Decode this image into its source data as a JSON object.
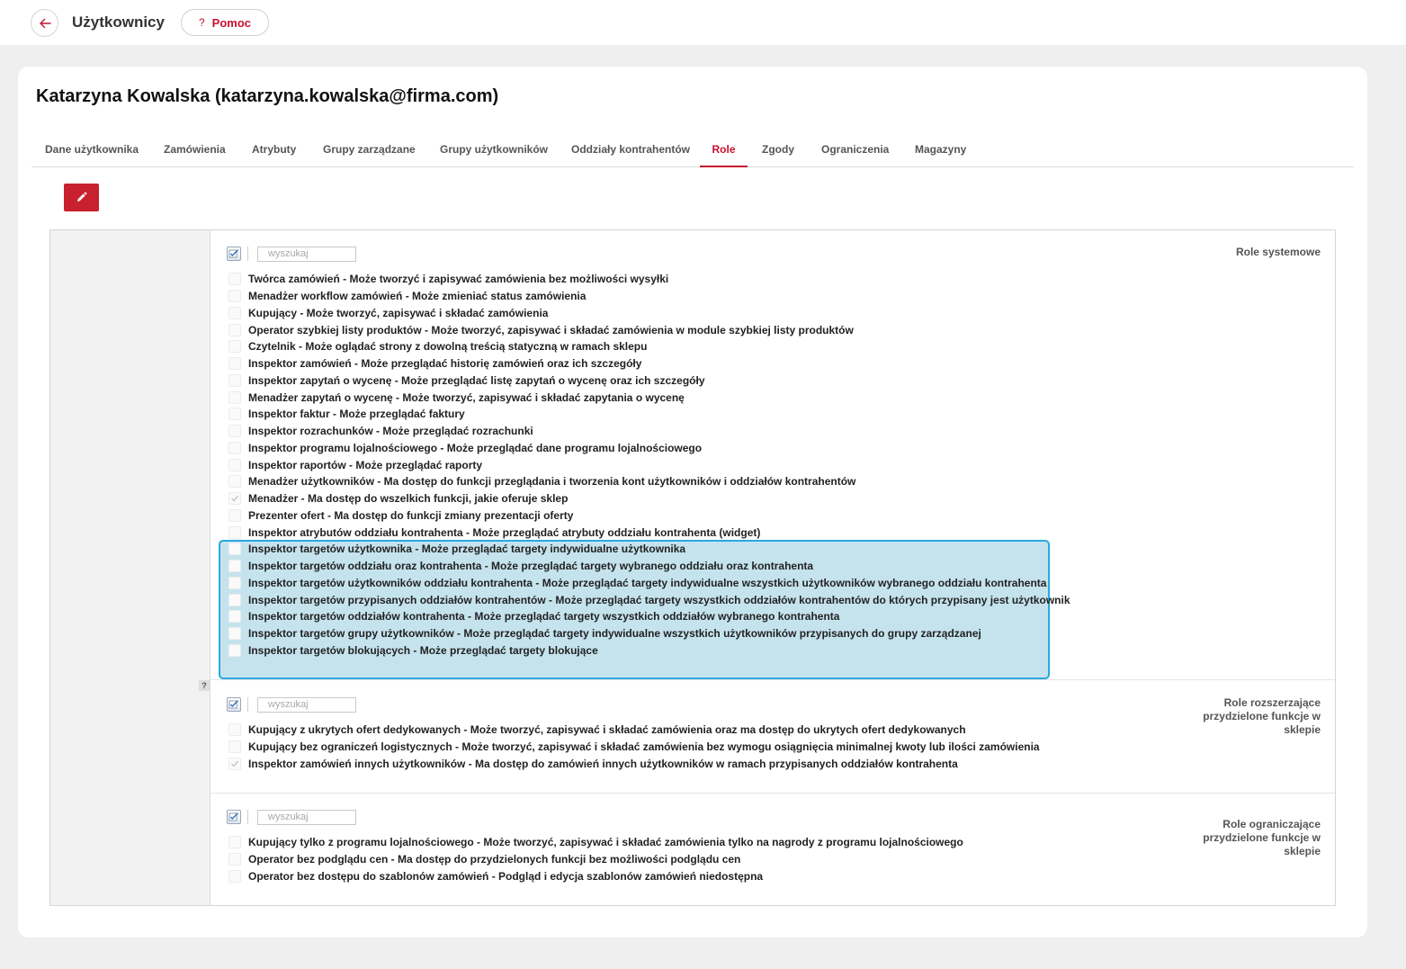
{
  "header": {
    "title": "Użytkownicy",
    "help_label": "Pomoc",
    "help_icon": "?"
  },
  "user": {
    "heading": "Katarzyna Kowalska (katarzyna.kowalska@firma.com)"
  },
  "tabs": [
    {
      "label": "Dane użytkownika"
    },
    {
      "label": "Zamówienia"
    },
    {
      "label": "Atrybuty"
    },
    {
      "label": "Grupy zarządzane"
    },
    {
      "label": "Grupy użytkowników"
    },
    {
      "label": "Oddziały kontrahentów"
    },
    {
      "label": "Role",
      "active": true
    },
    {
      "label": "Zgody"
    },
    {
      "label": "Ograniczenia"
    },
    {
      "label": "Magazyny"
    }
  ],
  "colors": {
    "accent": "#c8102e",
    "highlight_border": "#2aa8df",
    "highlight_fill": "#a9d5e3"
  },
  "sections": [
    {
      "label": "Role systemowe",
      "search_placeholder": "wyszukaj",
      "roles": [
        {
          "text": "Twórca zamówień - Może tworzyć i zapisywać zamówienia bez możliwości wysyłki",
          "checked": false
        },
        {
          "text": "Menadżer workflow zamówień - Może zmieniać status zamówienia",
          "checked": false
        },
        {
          "text": "Kupujący - Może tworzyć, zapisywać i składać zamówienia",
          "checked": false
        },
        {
          "text": "Operator szybkiej listy produktów - Może tworzyć, zapisywać i składać zamówienia w module szybkiej listy produktów",
          "checked": false
        },
        {
          "text": "Czytelnik - Może oglądać strony z dowolną treścią statyczną w ramach sklepu",
          "checked": false
        },
        {
          "text": "Inspektor zamówień - Może przeglądać historię zamówień oraz ich szczegóły",
          "checked": false
        },
        {
          "text": "Inspektor zapytań o wycenę - Może przeglądać listę zapytań o wycenę oraz ich szczegóły",
          "checked": false
        },
        {
          "text": "Menadżer zapytań o wycenę - Może tworzyć, zapisywać i składać zapytania o wycenę",
          "checked": false
        },
        {
          "text": "Inspektor faktur - Może przeglądać faktury",
          "checked": false
        },
        {
          "text": "Inspektor rozrachunków - Może przeglądać rozrachunki",
          "checked": false
        },
        {
          "text": "Inspektor programu lojalnościowego - Może przeglądać dane programu lojalnościowego",
          "checked": false
        },
        {
          "text": "Inspektor raportów - Może przeglądać raporty",
          "checked": false
        },
        {
          "text": "Menadżer użytkowników - Ma dostęp do funkcji przeglądania i tworzenia kont użytkowników i oddziałów kontrahentów",
          "checked": false
        },
        {
          "text": "Menadżer - Ma dostęp do wszelkich funkcji, jakie oferuje sklep",
          "checked": true
        },
        {
          "text": "Prezenter ofert - Ma dostęp do funkcji zmiany prezentacji oferty",
          "checked": false
        },
        {
          "text": "Inspektor atrybutów oddziału kontrahenta - Może przeglądać atrybuty oddziału kontrahenta (widget)",
          "checked": false
        },
        {
          "text": "Inspektor targetów użytkownika - Może przeglądać targety indywidualne użytkownika",
          "checked": false
        },
        {
          "text": "Inspektor targetów oddziału oraz kontrahenta - Może przeglądać targety wybranego oddziału oraz kontrahenta",
          "checked": false
        },
        {
          "text": "Inspektor targetów użytkowników oddziału kontrahenta - Może przeglądać targety indywidualne wszystkich użytkowników wybranego oddziału kontrahenta",
          "checked": false
        },
        {
          "text": "Inspektor targetów przypisanych oddziałów kontrahentów - Może przeglądać targety wszystkich oddziałów kontrahentów do których przypisany jest użytkownik",
          "checked": false
        },
        {
          "text": "Inspektor targetów oddziałów kontrahenta - Może przeglądać targety wszystkich oddziałów wybranego kontrahenta",
          "checked": false
        },
        {
          "text": "Inspektor targetów grupy użytkowników - Może przeglądać targety indywidualne wszystkich użytkowników przypisanych do grupy zarządzanej",
          "checked": false
        },
        {
          "text": "Inspektor targetów blokujących - Może przeglądać targety blokujące",
          "checked": false
        }
      ]
    },
    {
      "label": "Role rozszerzające przydzielone funkcje w sklepie",
      "help_marker": "?",
      "search_placeholder": "wyszukaj",
      "roles": [
        {
          "text": "Kupujący z ukrytych ofert dedykowanych - Może tworzyć, zapisywać i składać zamówienia oraz ma dostęp do ukrytych ofert dedykowanych",
          "checked": false
        },
        {
          "text": "Kupujący bez ograniczeń logistycznych - Może tworzyć, zapisywać i składać zamówienia bez wymogu osiągnięcia minimalnej kwoty lub ilości zamówienia",
          "checked": false
        },
        {
          "text": "Inspektor zamówień innych użytkowników - Ma dostęp do zamówień innych użytkowników w ramach przypisanych oddziałów kontrahenta",
          "checked": true
        }
      ]
    },
    {
      "label": "Role ograniczające przydzielone funkcje w sklepie",
      "search_placeholder": "wyszukaj",
      "roles": [
        {
          "text": "Kupujący tylko z programu lojalnościowego - Może tworzyć, zapisywać i składać zamówienia tylko na nagrody z programu lojalnościowego",
          "checked": false
        },
        {
          "text": "Operator bez podglądu cen - Ma dostęp do przydzielonych funkcji bez możliwości podglądu cen",
          "checked": false
        },
        {
          "text": "Operator bez dostępu do szablonów zamówień - Podgląd i edycja szablonów zamówień niedostępna",
          "checked": false
        }
      ]
    }
  ]
}
